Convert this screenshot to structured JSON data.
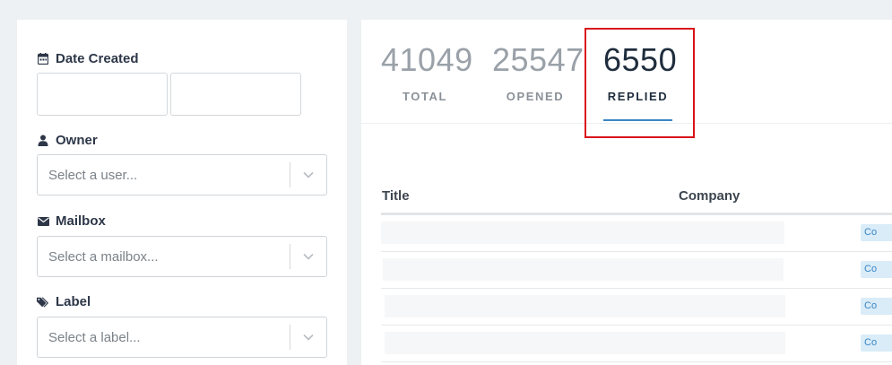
{
  "filters": {
    "date_created_label": "Date Created",
    "owner_label": "Owner",
    "owner_placeholder": "Select a user...",
    "mailbox_label": "Mailbox",
    "mailbox_placeholder": "Select a mailbox...",
    "label_label": "Label",
    "label_placeholder": "Select a label..."
  },
  "stats": [
    {
      "value": "41049",
      "label": "TOTAL"
    },
    {
      "value": "25547",
      "label": "OPENED"
    },
    {
      "value": "6550",
      "label": "REPLIED",
      "active": true
    }
  ],
  "table": {
    "columns": [
      "Title",
      "Company"
    ],
    "rows": [
      {
        "tag": "Co"
      },
      {
        "tag": "Co"
      },
      {
        "tag": "Co"
      },
      {
        "tag": "Co"
      }
    ]
  },
  "colors": {
    "accent": "#3a86c4",
    "highlight": "#d9141b",
    "tag_bg": "#d9ecf8"
  },
  "icons": {
    "date": "calendar-icon",
    "owner": "user-icon",
    "mailbox": "envelope-icon",
    "label": "tags-icon",
    "select_caret": "chevron-down-icon"
  }
}
